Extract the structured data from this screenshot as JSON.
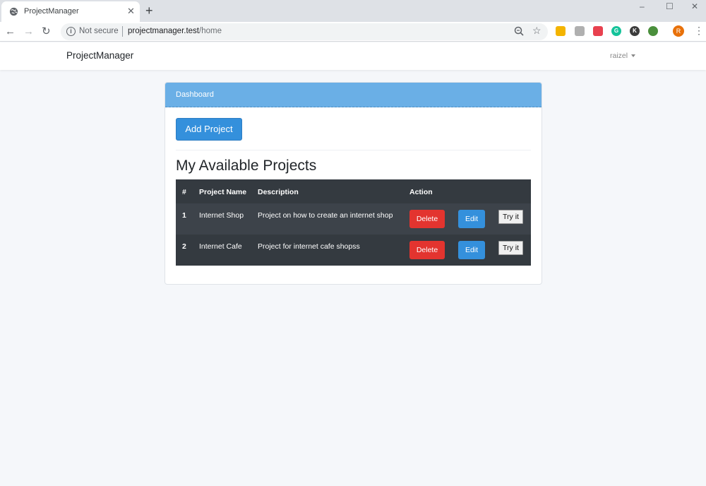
{
  "browser": {
    "tab_title": "ProjectManager",
    "tab_close": "✕",
    "new_tab": "+",
    "window_controls": [
      "–",
      "☐",
      "✕"
    ],
    "nav": {
      "back": "←",
      "forward": "→",
      "reload": "↻"
    },
    "security_label": "Not secure",
    "url_host": "projectmanager.test",
    "url_path": "/home",
    "star": "☆",
    "profile_initial": "R",
    "menu": "⋮",
    "extensions": [
      {
        "icon": "ext-yellow-icon",
        "color": "#f4b400",
        "glyph": ""
      },
      {
        "icon": "acrobat-icon",
        "color": "#b0b0b0",
        "glyph": ""
      },
      {
        "icon": "pocket-icon",
        "color": "#e8414f",
        "glyph": ""
      },
      {
        "icon": "grammarly-icon",
        "color": "#15c39a",
        "glyph": "G"
      },
      {
        "icon": "ext-k-icon",
        "color": "#3c3c3c",
        "glyph": "K"
      },
      {
        "icon": "ext-globe-icon",
        "color": "#4a8f3c",
        "glyph": ""
      }
    ]
  },
  "app": {
    "brand": "ProjectManager",
    "user": "raizel"
  },
  "card": {
    "header": "Dashboard",
    "add_button": "Add Project",
    "section_title": "My Available Projects"
  },
  "table": {
    "headers": {
      "num": "#",
      "name": "Project Name",
      "description": "Description",
      "action": "Action"
    },
    "rows": [
      {
        "num": "1",
        "name": "Internet Shop",
        "description": "Project on how to create an internet shop"
      },
      {
        "num": "2",
        "name": "Internet Cafe",
        "description": "Project for internet cafe shopss"
      }
    ],
    "delete_label": "Delete",
    "edit_label": "Edit",
    "try_label": "Try it"
  },
  "colors": {
    "header_blue": "#6aafe6",
    "primary": "#3490dc",
    "danger": "#e3342f",
    "table_dark": "#343a40"
  }
}
